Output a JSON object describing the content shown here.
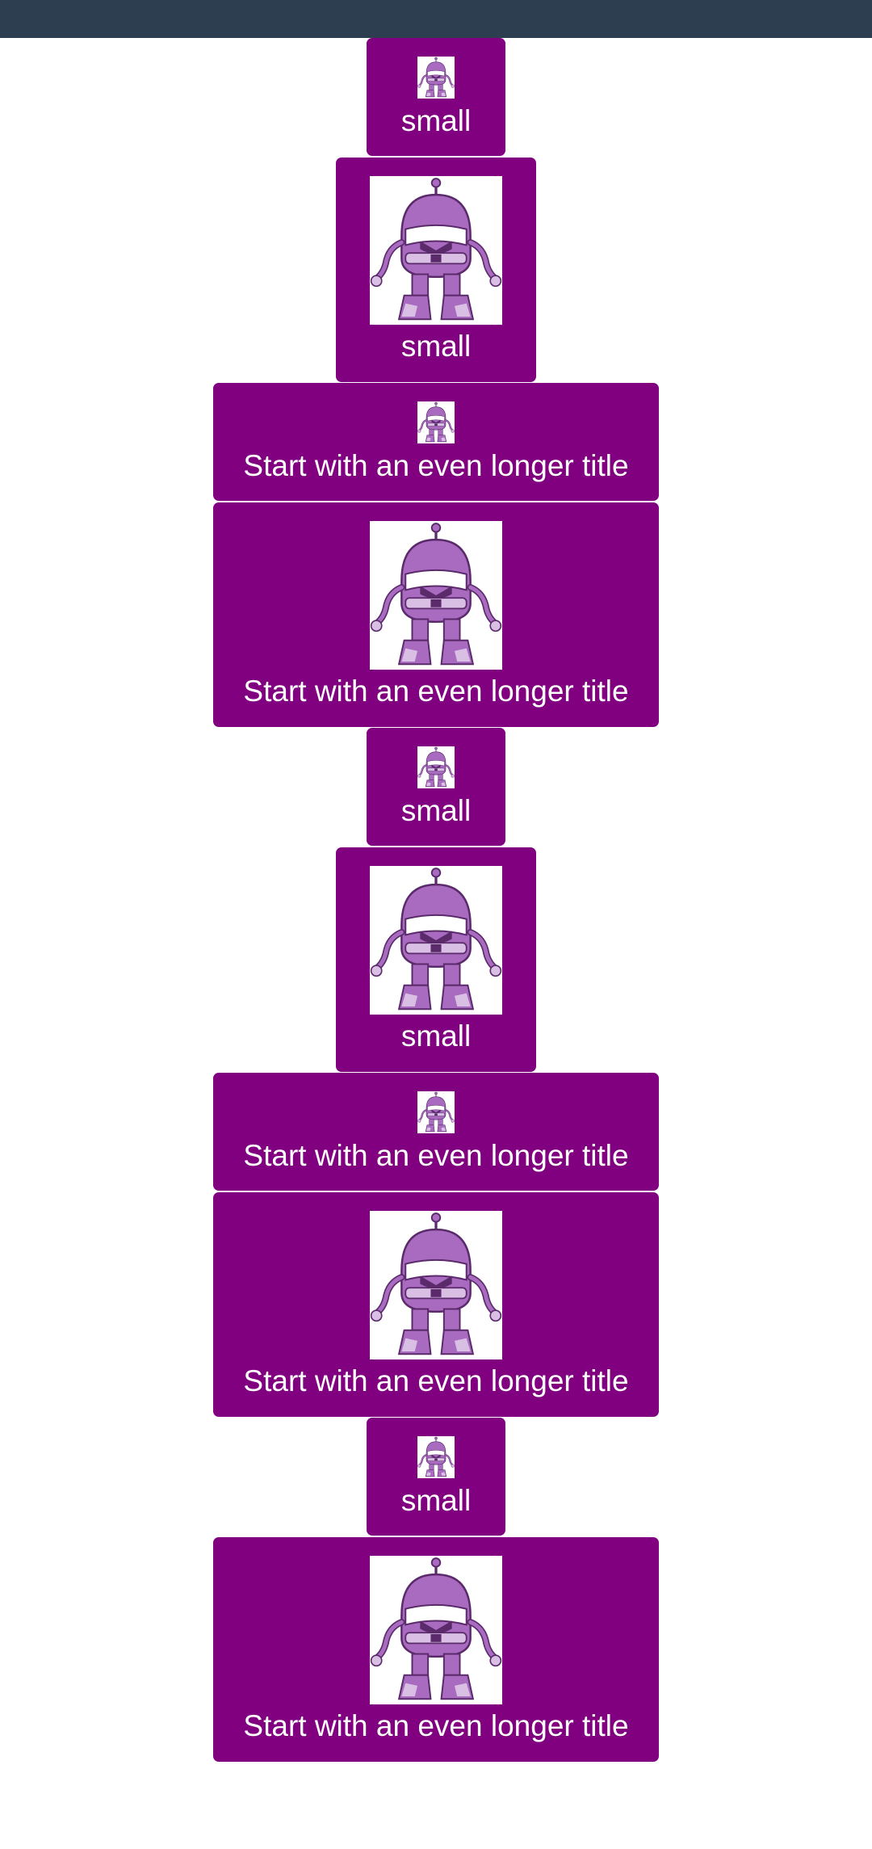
{
  "colors": {
    "status_bar": "#2d3e50",
    "card_background": "#800080",
    "card_text": "#ffffff",
    "robot_body": "#a86bbf",
    "robot_light": "#d9bfe4",
    "robot_dark": "#5a2a6b"
  },
  "cards": [
    {
      "title": "small",
      "image": "robot-icon",
      "size": "small"
    },
    {
      "title": "small",
      "image": "robot-icon",
      "size": "medium"
    },
    {
      "title": "Start with an even longer title",
      "image": "robot-icon",
      "size": "small"
    },
    {
      "title": "Start with an even longer title",
      "image": "robot-icon",
      "size": "large"
    },
    {
      "title": "small",
      "image": "robot-icon",
      "size": "small"
    },
    {
      "title": "small",
      "image": "robot-icon",
      "size": "medium"
    },
    {
      "title": "Start with an even longer title",
      "image": "robot-icon",
      "size": "small"
    },
    {
      "title": "Start with an even longer title",
      "image": "robot-icon",
      "size": "large"
    },
    {
      "title": "small",
      "image": "robot-icon",
      "size": "small"
    },
    {
      "title": "Start with an even longer title",
      "image": "robot-icon",
      "size": "large"
    }
  ]
}
